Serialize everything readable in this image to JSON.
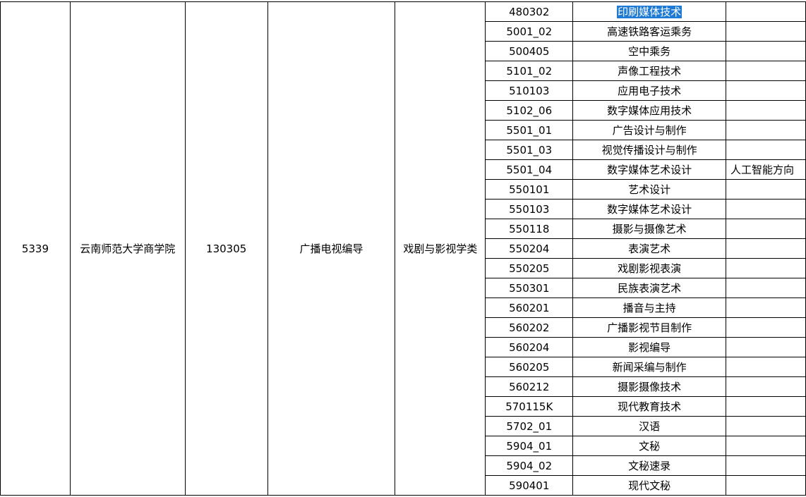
{
  "record": {
    "code": "5339",
    "school": "云南师范大学商学院",
    "major_code": "130305",
    "major": "广播电视编导",
    "category": "戏剧与影视学类"
  },
  "rows": [
    {
      "code": "480302",
      "name": "印刷媒体技术",
      "remark": "",
      "selected": true
    },
    {
      "code": "5001_02",
      "name": "高速铁路客运乘务",
      "remark": ""
    },
    {
      "code": "500405",
      "name": "空中乘务",
      "remark": ""
    },
    {
      "code": "5101_02",
      "name": "声像工程技术",
      "remark": ""
    },
    {
      "code": "510103",
      "name": "应用电子技术",
      "remark": ""
    },
    {
      "code": "5102_06",
      "name": "数字媒体应用技术",
      "remark": ""
    },
    {
      "code": "5501_01",
      "name": "广告设计与制作",
      "remark": ""
    },
    {
      "code": "5501_03",
      "name": "视觉传播设计与制作",
      "remark": ""
    },
    {
      "code": "5501_04",
      "name": "数字媒体艺术设计",
      "remark": "人工智能方向"
    },
    {
      "code": "550101",
      "name": "艺术设计",
      "remark": ""
    },
    {
      "code": "550103",
      "name": "数字媒体艺术设计",
      "remark": ""
    },
    {
      "code": "550118",
      "name": "摄影与摄像艺术",
      "remark": ""
    },
    {
      "code": "550204",
      "name": "表演艺术",
      "remark": ""
    },
    {
      "code": "550205",
      "name": "戏剧影视表演",
      "remark": ""
    },
    {
      "code": "550301",
      "name": "民族表演艺术",
      "remark": ""
    },
    {
      "code": "560201",
      "name": "播音与主持",
      "remark": ""
    },
    {
      "code": "560202",
      "name": "广播影视节目制作",
      "remark": ""
    },
    {
      "code": "560204",
      "name": "影视编导",
      "remark": ""
    },
    {
      "code": "560205",
      "name": "新闻采编与制作",
      "remark": ""
    },
    {
      "code": "560212",
      "name": "摄影摄像技术",
      "remark": ""
    },
    {
      "code": "570115K",
      "name": "现代教育技术",
      "remark": ""
    },
    {
      "code": "5702_01",
      "name": "汉语",
      "remark": ""
    },
    {
      "code": "5904_01",
      "name": "文秘",
      "remark": ""
    },
    {
      "code": "5904_02",
      "name": "文秘速录",
      "remark": ""
    },
    {
      "code": "590401",
      "name": "现代文秘",
      "remark": ""
    }
  ]
}
